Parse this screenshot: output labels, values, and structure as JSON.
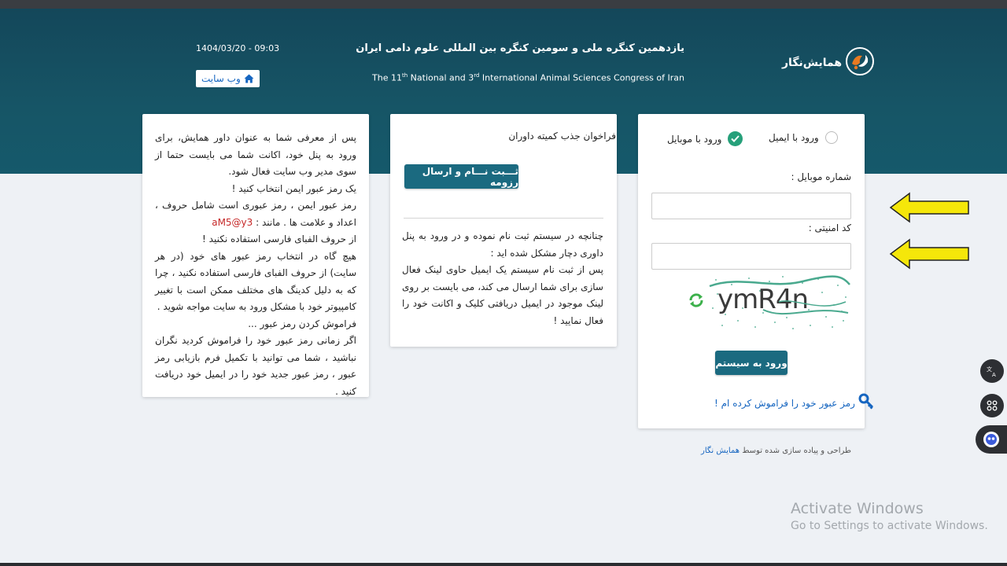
{
  "header": {
    "datetime": "1404/03/20 - 09:03",
    "website_button": "وب سایت",
    "title_fa": "یازدهمین کنگره ملی و سومین کنگره بین المللی علوم دامی ایران",
    "title_en_parts": [
      "The 11",
      "th",
      " National and 3",
      "rd",
      " International Animal Sciences Congress of Iran"
    ],
    "logo_text": "همایش‌نگار"
  },
  "left_card": {
    "lines": [
      "پس از معرفی شما به عنوان داور همایش، برای ورود به پنل خود، اکانت شما می بایست حتما از سوی مدیر وب سایت فعال شود.",
      "یک رمز عبور ایمن انتخاب کنید !",
      "رمز عبور ایمن ، رمز عبوری است شامل حروف ، اعداد و علامت ها . مانند :",
      "aM5@y3",
      "از حروف الفبای فارسی استفاده نکنید !",
      "هیچ گاه در انتخاب رمز عبور های خود (در هر سایت) از حروف الفبای فارسی استفاده نکنید ، چرا که به دلیل کدینگ های مختلف ممکن است با تغییر کامپیوتر خود با مشکل ورود به سایت مواجه شوید .",
      "فراموش کردن رمز عبور ...",
      "اگر زمانی رمز عبور خود را فراموش کردید نگران نباشید ، شما می توانید با تکمیل فرم بازیابی رمز عبور ، رمز عبور جدید خود را در ایمیل خود دریافت کنید ."
    ]
  },
  "mid_card": {
    "title": "فراخوان جذب کمیته داوران",
    "register_button": "ثـــبت نـــام و ارسال رزومه",
    "info_lines": [
      "چنانچه در سیستم ثبت نام نموده و در ورود به پنل داوری دچار مشکل شده اید :",
      "پس از ثبت نام سیستم یک ایمیل حاوی لینک فعال سازی برای شما ارسال می کند، می بایست بر روی لینک موجود در ایمیل دریافتی کلیک و اکانت خود را فعال نمایید !"
    ]
  },
  "login": {
    "radio_email": "ورود با ایمیل",
    "radio_mobile": "ورود با موبایل",
    "selected": "mobile",
    "mobile_label": "شماره موبایل :",
    "mobile_value": "",
    "security_label": "کد امنیتی :",
    "security_value": "",
    "captcha_text": "ymR4n",
    "login_button": "ورود به سیستم",
    "forgot_link": "رمز عبور خود را فراموش کرده ام !"
  },
  "footer": {
    "credit_prefix": "طراحی و پیاده سازی شده توسط",
    "credit_brand": "همایش نگار"
  },
  "watermark": {
    "line1": "Activate Windows",
    "line2": "Go to Settings to activate Windows."
  },
  "colors": {
    "header_bg": "#165566",
    "button_bg": "#1b6a80",
    "link": "#1565c0",
    "checked": "#26a07a",
    "arrow": "#f5e70a"
  }
}
